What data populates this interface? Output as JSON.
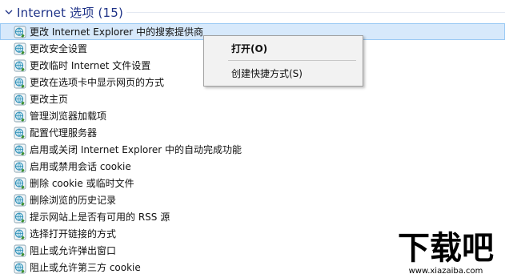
{
  "group": {
    "title": "Internet 选项 (15)",
    "accent": "#1e3287"
  },
  "items": [
    {
      "label": "更改 Internet Explorer 中的搜索提供商",
      "selected": true
    },
    {
      "label": "更改安全设置"
    },
    {
      "label": "更改临时 Internet 文件设置"
    },
    {
      "label": "更改在选项卡中显示网页的方式"
    },
    {
      "label": "更改主页"
    },
    {
      "label": "管理浏览器加载项"
    },
    {
      "label": "配置代理服务器"
    },
    {
      "label": "启用或关闭 Internet Explorer 中的自动完成功能"
    },
    {
      "label": "启用或禁用会话 cookie"
    },
    {
      "label": "删除 cookie 或临时文件"
    },
    {
      "label": "删除浏览的历史记录"
    },
    {
      "label": "提示网站上是否有可用的 RSS 源"
    },
    {
      "label": "选择打开链接的方式"
    },
    {
      "label": "阻止或允许弹出窗口"
    },
    {
      "label": "阻止或允许第三方 cookie"
    }
  ],
  "context_menu": {
    "open": "打开(O)",
    "create_shortcut": "创建快捷方式(S)"
  },
  "watermark": {
    "brand": "下载吧",
    "url": "www.xiazaiba.com"
  },
  "icon": "internet-options-icon"
}
